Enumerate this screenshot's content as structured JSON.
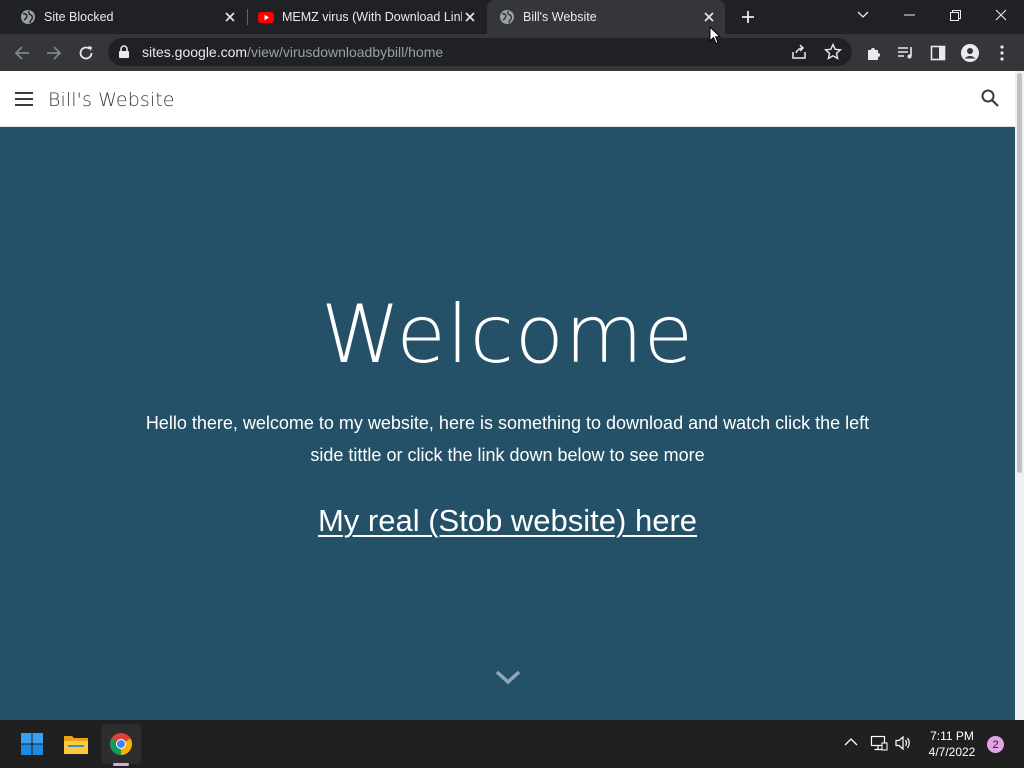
{
  "browser": {
    "tabs": [
      {
        "title": "Site Blocked",
        "favicon": "globe-icon"
      },
      {
        "title": "MEMZ virus (With Download Link)",
        "favicon": "youtube-icon"
      },
      {
        "title": "Bill's Website",
        "favicon": "globe-icon",
        "active": true
      }
    ],
    "address_bar": {
      "host": "sites.google.com",
      "path": "/view/virusdownloadbybill/home"
    }
  },
  "site": {
    "title": "Bill's Website",
    "hero": {
      "heading": "Welcome",
      "body": "Hello there, welcome to my website, here is something to download and watch click the left side tittle or click the link down below to see more",
      "link_text": "My real (Stob website) here"
    }
  },
  "taskbar": {
    "clock_time": "7:11 PM",
    "clock_date": "4/7/2022",
    "notification_count": "2"
  },
  "colors": {
    "hero_background": "#245168",
    "browser_frame": "#202124",
    "toolbar": "#35363a",
    "taskbar": "#202020"
  }
}
